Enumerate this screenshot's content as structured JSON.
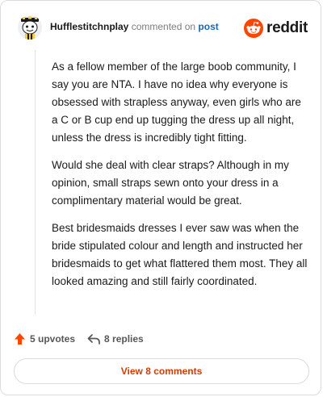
{
  "comment": {
    "author": "Hufflestitchnplay",
    "action_text": "commented on",
    "post_link_label": "post",
    "paragraphs": [
      "As a fellow member of the large boob community, I say you are NTA. I have no idea why everyone is obsessed with strapless anyway, even girls who are a C or B cup end up tugging the dress up all night, unless the dress is incredibly tight fitting.",
      "Would she deal with clear straps? Although in my opinion, small straps sewn onto your dress in a complimentary material would be great.",
      "Best bridesmaids dresses I ever saw was when the bride stipulated colour and length and instructed her bridesmaids to get what flattered them most. They all looked amazing and still fairly coordinated."
    ]
  },
  "brand": {
    "name": "reddit",
    "icon": "reddit-snoo-icon",
    "color": "#ff4500"
  },
  "stats": {
    "upvotes_label": "5 upvotes",
    "upvote_icon": "upvote-arrow-icon",
    "replies_label": "8 replies",
    "reply_icon": "reply-arrow-icon"
  },
  "actions": {
    "view_comments_label": "View 8 comments"
  },
  "colors": {
    "link": "#1967b2",
    "accent": "#d93a00",
    "upvote": "#ff4500",
    "text": "#1a1a1b",
    "muted": "#7c7c7c"
  }
}
